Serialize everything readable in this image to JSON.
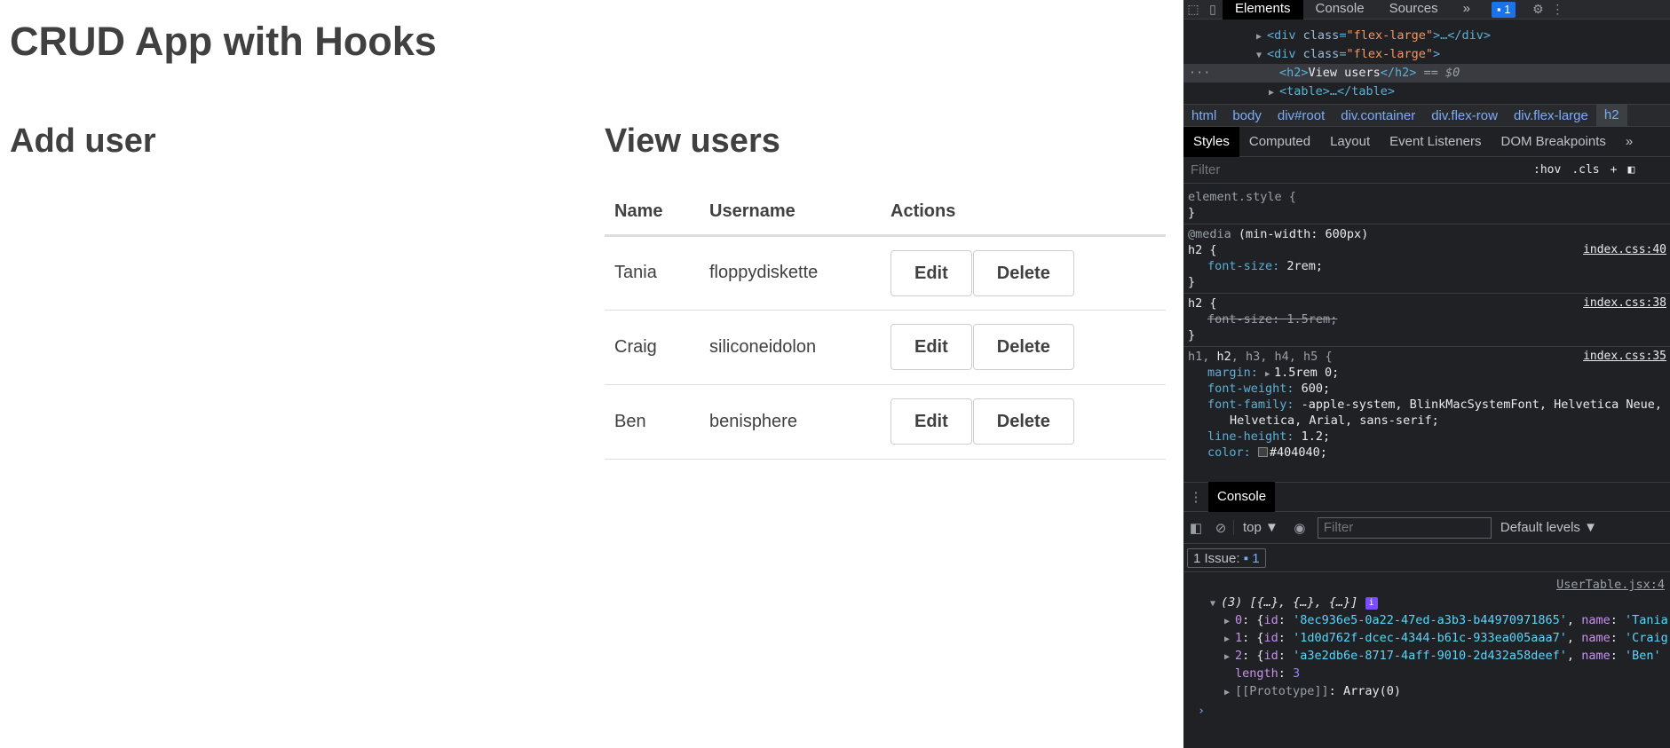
{
  "app": {
    "title": "CRUD App with Hooks",
    "add_heading": "Add user",
    "view_heading": "View users",
    "table": {
      "headers": [
        "Name",
        "Username",
        "Actions"
      ],
      "rows": [
        {
          "name": "Tania",
          "username": "floppydiskette"
        },
        {
          "name": "Craig",
          "username": "siliconeidolon"
        },
        {
          "name": "Ben",
          "username": "benisphere"
        }
      ],
      "edit_label": "Edit",
      "delete_label": "Delete"
    }
  },
  "devtools": {
    "tabs": [
      "Elements",
      "Console",
      "Sources",
      "»"
    ],
    "issue_count": "1",
    "dom": {
      "line1_tag": "div",
      "line1_attr": "class",
      "line1_val": "\"flex-large\"",
      "line1_rest": "…</div>",
      "line2_tag": "div",
      "line2_attr": "class",
      "line2_val": "\"flex-large\"",
      "line3_text": "View users",
      "line3_suffix": "== $0",
      "line4": "…</table>"
    },
    "breadcrumbs": [
      "html",
      "body",
      "div#root",
      "div.container",
      "div.flex-row",
      "div.flex-large",
      "h2"
    ],
    "style_tabs": [
      "Styles",
      "Computed",
      "Layout",
      "Event Listeners",
      "DOM Breakpoints",
      "»"
    ],
    "filter_placeholder": "Filter",
    "hov": ":hov",
    "cls": ".cls",
    "styles": {
      "element_style": "element.style {",
      "close": "}",
      "media_kw": "@media",
      "media_cond": "(min-width: 600px)",
      "h2_sel": "h2 {",
      "fs_prop": "font-size",
      "fs_2rem": "2rem;",
      "fs_15rem": "1.5rem;",
      "src1": "index.css:40",
      "src2": "index.css:38",
      "src3": "index.css:35",
      "h_sel_h1": "h1, ",
      "h_sel_h2": "h2",
      "h_sel_rest": ", h3, h4, h5 {",
      "margin_prop": "margin",
      "margin_val": "1.5rem 0;",
      "fw_prop": "font-weight",
      "fw_val": "600;",
      "ff_prop": "font-family",
      "ff_val": "-apple-system, BlinkMacSystemFont, Helvetica Neue,",
      "ff_val2": "Helvetica, Arial, sans-serif;",
      "lh_prop": "line-height",
      "lh_val": "1.2;",
      "color_prop": "color",
      "color_val": "#404040;"
    },
    "drawer_tab": "Console",
    "console": {
      "context": "top ▼",
      "filter_placeholder": "Filter",
      "levels": "Default levels ▼",
      "issues_label": "1 Issue:",
      "issues_count": "1",
      "source": "UserTable.jsx:4",
      "array_summary": "(3) [{…}, {…}, {…}]",
      "items": [
        {
          "idx": "0",
          "id": "'8ec936e5-0a22-47ed-a3b3-b44970971865'",
          "name": "'Tania"
        },
        {
          "idx": "1",
          "id": "'1d0d762f-dcec-4344-b61c-933ea005aaa7'",
          "name": "'Craig"
        },
        {
          "idx": "2",
          "id": "'a3e2db6e-8717-4aff-9010-2d432a58deef'",
          "name": "'Ben'"
        }
      ],
      "length_key": "length",
      "length_val": "3",
      "proto": "[[Prototype]]",
      "proto_val": "Array(0)",
      "prompt": "›"
    }
  }
}
